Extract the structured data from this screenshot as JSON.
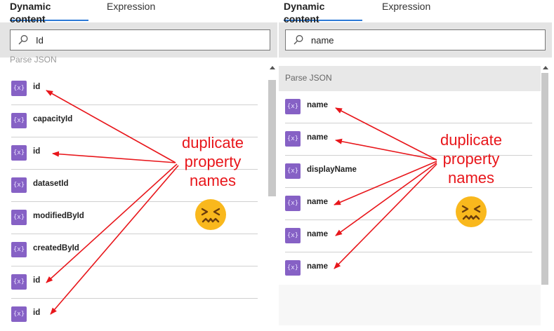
{
  "left_panel": {
    "tabs": [
      {
        "label": "Dynamic content",
        "active": true
      },
      {
        "label": "Expression",
        "active": false
      }
    ],
    "search": {
      "value": "Id",
      "placeholder": ""
    },
    "section_label": "Parse JSON",
    "items": [
      {
        "label": "id"
      },
      {
        "label": "capacityId"
      },
      {
        "label": "id"
      },
      {
        "label": "datasetId"
      },
      {
        "label": "modifiedById"
      },
      {
        "label": "createdById"
      },
      {
        "label": "id"
      },
      {
        "label": "id"
      }
    ]
  },
  "right_panel": {
    "tabs": [
      {
        "label": "Dynamic content",
        "active": true
      },
      {
        "label": "Expression",
        "active": false
      }
    ],
    "search": {
      "value": "name",
      "placeholder": ""
    },
    "section_label": "Parse JSON",
    "items": [
      {
        "label": "name"
      },
      {
        "label": "name"
      },
      {
        "label": "displayName"
      },
      {
        "label": "name"
      },
      {
        "label": "name"
      },
      {
        "label": "name"
      }
    ]
  },
  "annotation": {
    "lines": [
      "duplicate",
      "property",
      "names"
    ],
    "color": "#e8161b",
    "emoji": "confounded-face"
  },
  "colors": {
    "accent": "#2b79d6",
    "token_icon": "#8661c5",
    "search_band": "#e4e4e4"
  },
  "icons": {
    "search": "search-icon",
    "token": "dynamic-content-token-icon",
    "scroll_up": "scroll-up-arrow-icon"
  }
}
